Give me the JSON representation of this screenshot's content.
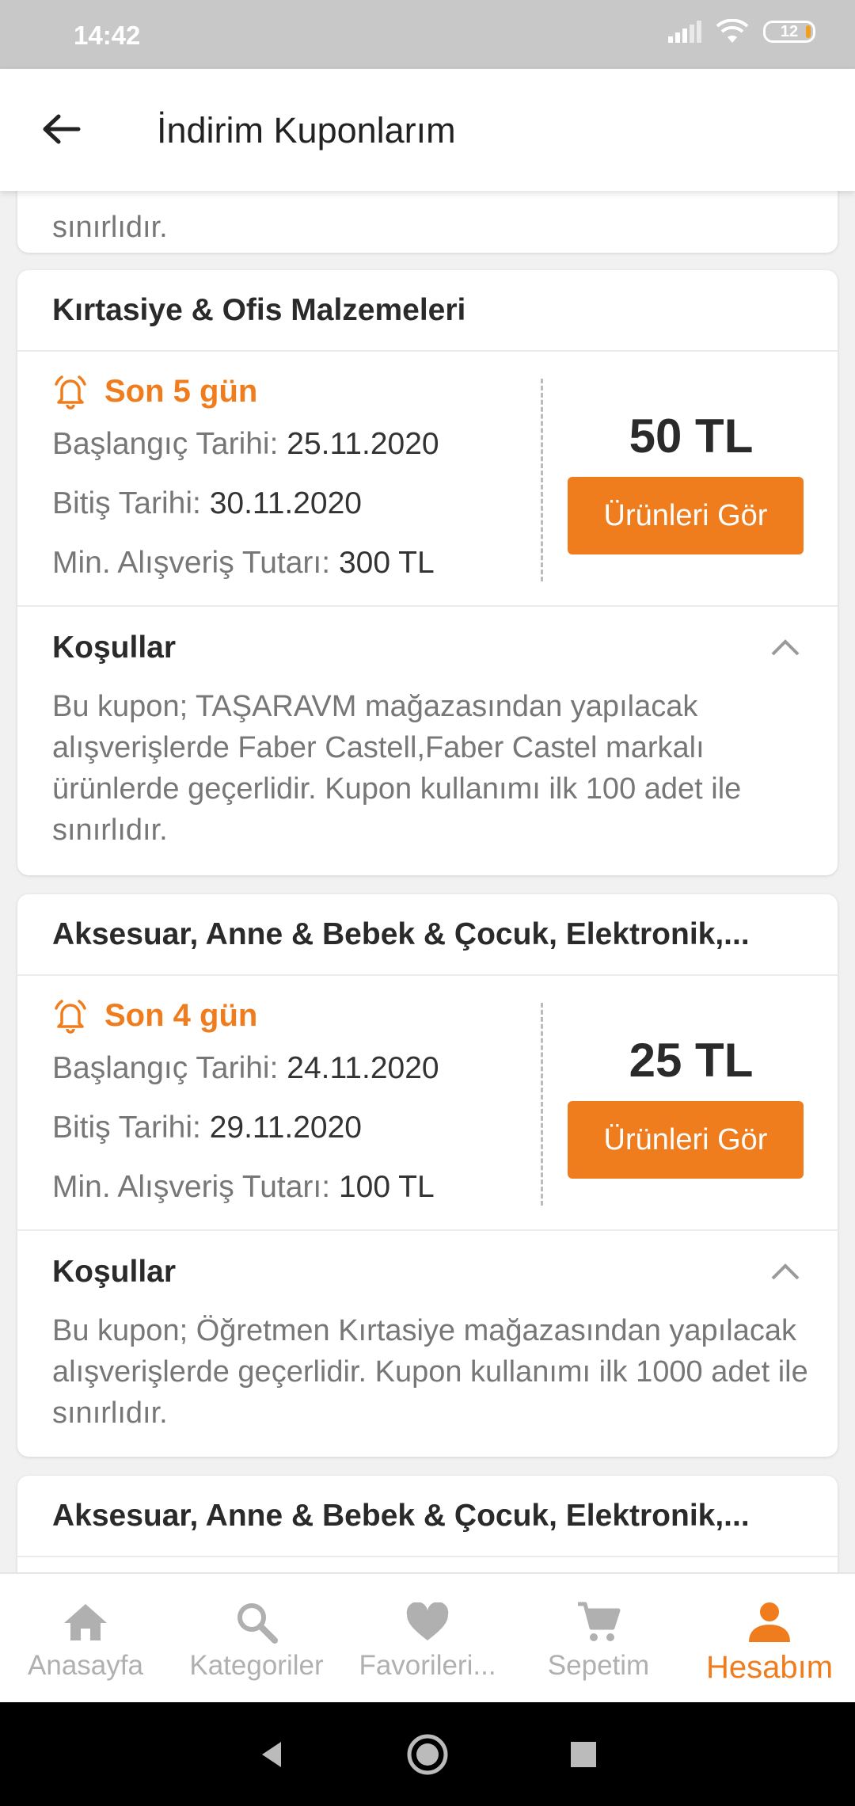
{
  "status": {
    "time": "14:42",
    "battery": "12"
  },
  "header": {
    "title": "İndirim Kuponlarım"
  },
  "partial_card": {
    "text": "sınırlıdır."
  },
  "coupons": [
    {
      "category": "Kırtasiye & Ofis Malzemeleri",
      "remaining": "Son 5 gün",
      "start_label": "Başlangıç Tarihi:",
      "start_value": "25.11.2020",
      "end_label": "Bitiş Tarihi:",
      "end_value": "30.11.2020",
      "min_label": "Min. Alışveriş Tutarı:",
      "min_value": "300 TL",
      "amount": "50 TL",
      "button": "Ürünleri Gör",
      "terms_title": "Koşullar",
      "terms_text": "Bu kupon; TAŞARAVM mağazasından yapılacak alışverişlerde Faber Castell,Faber Castel markalı ürünlerde geçerlidir. Kupon kullanımı ilk 100 adet ile sınırlıdır."
    },
    {
      "category": "Aksesuar, Anne & Bebek & Çocuk, Elektronik,...",
      "remaining": "Son 4 gün",
      "start_label": "Başlangıç Tarihi:",
      "start_value": "24.11.2020",
      "end_label": "Bitiş Tarihi:",
      "end_value": "29.11.2020",
      "min_label": "Min. Alışveriş Tutarı:",
      "min_value": "100 TL",
      "amount": "25 TL",
      "button": "Ürünleri Gör",
      "terms_title": "Koşullar",
      "terms_text": "Bu kupon; Öğretmen Kırtasiye mağazasından yapılacak alışverişlerde geçerlidir. Kupon kullanımı ilk 1000 adet ile sınırlıdır."
    },
    {
      "category": "Aksesuar, Anne & Bebek & Çocuk, Elektronik,..."
    }
  ],
  "nav": [
    {
      "label": "Anasayfa",
      "icon": "home-icon"
    },
    {
      "label": "Kategoriler",
      "icon": "search-icon"
    },
    {
      "label": "Favorileri...",
      "icon": "heart-icon"
    },
    {
      "label": "Sepetim",
      "icon": "cart-icon"
    },
    {
      "label": "Hesabım",
      "icon": "person-icon",
      "active": true
    }
  ],
  "colors": {
    "accent": "#f07d1d",
    "statusbar": "#c8c8c8"
  }
}
